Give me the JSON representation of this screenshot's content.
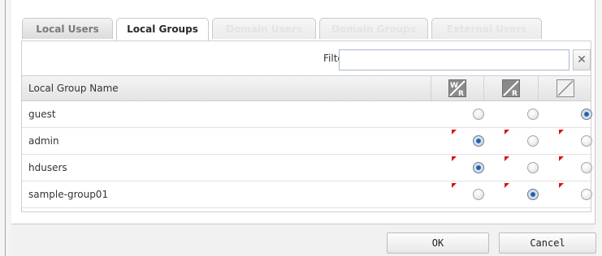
{
  "tabs": [
    {
      "label": "Local Users",
      "state": "normal"
    },
    {
      "label": "Local Groups",
      "state": "active"
    },
    {
      "label": "Domain Users",
      "state": "disabled"
    },
    {
      "label": "Domain Groups",
      "state": "disabled"
    },
    {
      "label": "External Users",
      "state": "disabled"
    }
  ],
  "filter": {
    "label": "Filter:",
    "value": "",
    "clear_icon": "close-icon"
  },
  "table": {
    "column_name": "Local Group Name",
    "permission_columns": [
      {
        "id": "read-write",
        "icon": "read-write-icon",
        "letters": [
          "W",
          "R"
        ]
      },
      {
        "id": "read-only",
        "icon": "read-only-icon",
        "letters": [
          "R"
        ]
      },
      {
        "id": "no-access",
        "icon": "no-access-icon",
        "letters": []
      }
    ],
    "rows": [
      {
        "name": "guest",
        "selected": 2,
        "changed": false
      },
      {
        "name": "admin",
        "selected": 0,
        "changed": true
      },
      {
        "name": "hdusers",
        "selected": 0,
        "changed": true
      },
      {
        "name": "sample-group01",
        "selected": 1,
        "changed": true
      }
    ]
  },
  "buttons": {
    "ok": "OK",
    "cancel": "Cancel"
  },
  "colors": {
    "checked": "#2c6fb8",
    "changed_flag": "#e01010"
  }
}
